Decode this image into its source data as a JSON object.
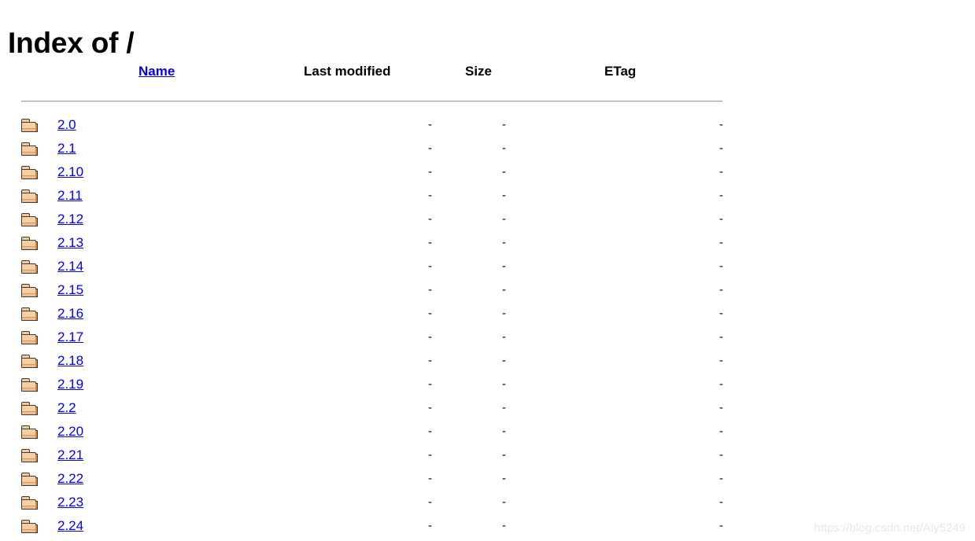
{
  "page": {
    "title": "Index of /",
    "watermark": "https://blog.csdn.net/Aiy5249"
  },
  "colors": {
    "link": "#0000ee",
    "text": "#000000",
    "rule": "#a0a0a0",
    "folder_fill": "#f7cfa4",
    "folder_outline": "#3a3a3a",
    "watermark": "#e8e8e8",
    "background": "#ffffff"
  },
  "table": {
    "headers": {
      "name": "Name",
      "last_modified": "Last modified",
      "size": "Size",
      "etag": "ETag"
    },
    "empty_value": "-",
    "icon": "folder-icon",
    "rows": [
      {
        "name": "2.0",
        "last_modified": "-",
        "size": "-",
        "etag": "-",
        "icon": "folder-icon"
      },
      {
        "name": "2.1",
        "last_modified": "-",
        "size": "-",
        "etag": "-",
        "icon": "folder-icon"
      },
      {
        "name": "2.10",
        "last_modified": "-",
        "size": "-",
        "etag": "-",
        "icon": "folder-icon"
      },
      {
        "name": "2.11",
        "last_modified": "-",
        "size": "-",
        "etag": "-",
        "icon": "folder-icon"
      },
      {
        "name": "2.12",
        "last_modified": "-",
        "size": "-",
        "etag": "-",
        "icon": "folder-icon"
      },
      {
        "name": "2.13",
        "last_modified": "-",
        "size": "-",
        "etag": "-",
        "icon": "folder-icon"
      },
      {
        "name": "2.14",
        "last_modified": "-",
        "size": "-",
        "etag": "-",
        "icon": "folder-icon"
      },
      {
        "name": "2.15",
        "last_modified": "-",
        "size": "-",
        "etag": "-",
        "icon": "folder-icon"
      },
      {
        "name": "2.16",
        "last_modified": "-",
        "size": "-",
        "etag": "-",
        "icon": "folder-icon"
      },
      {
        "name": "2.17",
        "last_modified": "-",
        "size": "-",
        "etag": "-",
        "icon": "folder-icon"
      },
      {
        "name": "2.18",
        "last_modified": "-",
        "size": "-",
        "etag": "-",
        "icon": "folder-icon"
      },
      {
        "name": "2.19",
        "last_modified": "-",
        "size": "-",
        "etag": "-",
        "icon": "folder-icon"
      },
      {
        "name": "2.2",
        "last_modified": "-",
        "size": "-",
        "etag": "-",
        "icon": "folder-icon"
      },
      {
        "name": "2.20",
        "last_modified": "-",
        "size": "-",
        "etag": "-",
        "icon": "folder-icon"
      },
      {
        "name": "2.21",
        "last_modified": "-",
        "size": "-",
        "etag": "-",
        "icon": "folder-icon"
      },
      {
        "name": "2.22",
        "last_modified": "-",
        "size": "-",
        "etag": "-",
        "icon": "folder-icon"
      },
      {
        "name": "2.23",
        "last_modified": "-",
        "size": "-",
        "etag": "-",
        "icon": "folder-icon"
      },
      {
        "name": "2.24",
        "last_modified": "-",
        "size": "-",
        "etag": "-",
        "icon": "folder-icon"
      }
    ]
  }
}
